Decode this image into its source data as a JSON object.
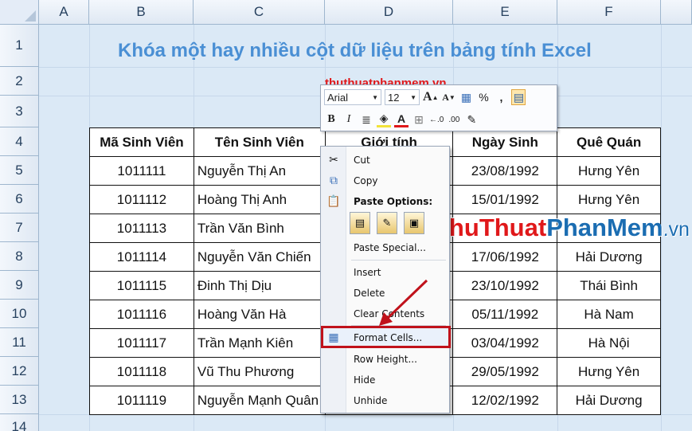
{
  "columns": [
    "A",
    "B",
    "C",
    "D",
    "E",
    "F"
  ],
  "rows": [
    "1",
    "2",
    "3",
    "4",
    "5",
    "6",
    "7",
    "8",
    "9",
    "10",
    "11",
    "12",
    "13",
    "14"
  ],
  "title": "Khóa một hay nhiều cột dữ liệu trên bảng tính Excel",
  "subtitle": "thuthuatphanmem.vn",
  "table": {
    "headers": [
      "Mã Sinh Viên",
      "Tên Sinh Viên",
      "Giới tính",
      "Ngày Sinh",
      "Quê Quán"
    ],
    "rows": [
      [
        "1011111",
        "Nguyễn Thị An",
        "",
        "23/08/1992",
        "Hưng Yên"
      ],
      [
        "1011112",
        "Hoàng Thị Anh",
        "",
        "15/01/1992",
        "Hưng Yên"
      ],
      [
        "1011113",
        "Trần Văn Bình",
        "",
        "",
        ""
      ],
      [
        "1011114",
        "Nguyễn Văn Chiến",
        "",
        "17/06/1992",
        "Hải Dương"
      ],
      [
        "1011115",
        "Đinh Thị Dịu",
        "",
        "23/10/1992",
        "Thái Bình"
      ],
      [
        "1011116",
        "Hoàng Văn Hà",
        "",
        "05/11/1992",
        "Hà Nam"
      ],
      [
        "1011117",
        "Trần Mạnh Kiên",
        "",
        "03/04/1992",
        "Hà Nội"
      ],
      [
        "1011118",
        "Vũ Thu Phương",
        "",
        "29/05/1992",
        "Hưng Yên"
      ],
      [
        "1011119",
        "Nguyễn Mạnh Quân",
        "",
        "12/02/1992",
        "Hải Dương"
      ]
    ]
  },
  "mini_toolbar": {
    "font": "Arial",
    "size": "12",
    "percent": "%",
    "comma": ",",
    "bold": "B",
    "italic": "I",
    "font_color_letter": "A",
    "grow_letter": "A",
    "shrink_letter": "A",
    "inc_decimal": "←.0",
    "dec_decimal": ".00"
  },
  "context_menu": {
    "cut": "Cut",
    "copy": "Copy",
    "paste_options": "Paste Options:",
    "paste_special": "Paste Special...",
    "insert": "Insert",
    "delete": "Delete",
    "clear_contents": "Clear Contents",
    "format_cells": "Format Cells...",
    "row_height": "Row Height...",
    "hide": "Hide",
    "unhide": "Unhide"
  },
  "watermark": {
    "part1": "Thu",
    "part2": "Thuat",
    "part3": "PhanMem",
    "part4": ".vn"
  },
  "colors": {
    "title": "#4a8fd4",
    "subtitle": "#e0181a",
    "highlight": "#c0121b",
    "arrow": "#c0121b"
  }
}
